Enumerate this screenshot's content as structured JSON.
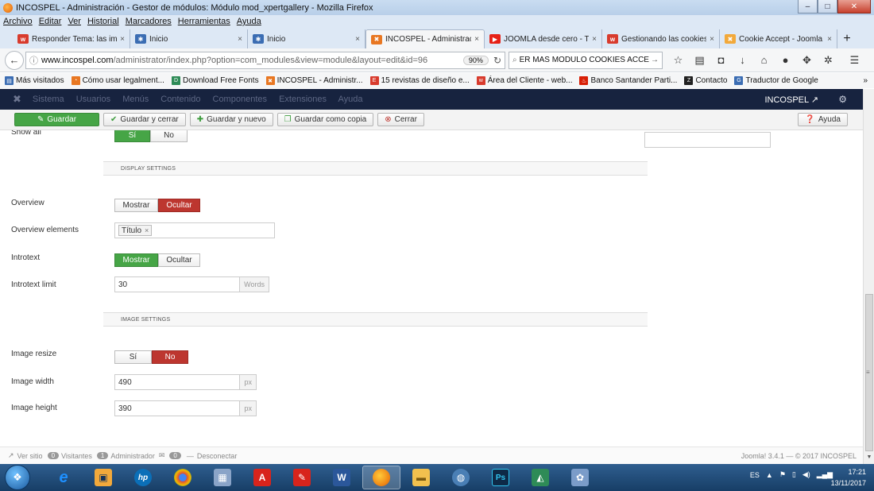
{
  "window": {
    "title": "INCOSPEL - Administración - Gestor de módulos: Módulo mod_xpertgallery - Mozilla Firefox",
    "minimize": "‒",
    "maximize": "□",
    "close": "✕"
  },
  "menubar": [
    "Archivo",
    "Editar",
    "Ver",
    "Historial",
    "Marcadores",
    "Herramientas",
    "Ayuda"
  ],
  "tabs": [
    {
      "label": "Responder Tema: las imá",
      "icon": "w-icon",
      "color": "#d83b2d"
    },
    {
      "label": "Inicio",
      "icon": "joomla-icon",
      "color": "#3b6db3"
    },
    {
      "label": "Inicio",
      "icon": "joomla-icon",
      "color": "#3b6db3"
    },
    {
      "label": "INCOSPEL - Administrac",
      "icon": "incospel-icon",
      "color": "#e87722"
    },
    {
      "label": "JOOMLA desde cero - Tu",
      "icon": "youtube-icon",
      "color": "#e62117"
    },
    {
      "label": "Gestionando las cookies",
      "icon": "w-icon",
      "color": "#d83b2d"
    },
    {
      "label": "Cookie Accept - Joomla",
      "icon": "cookie-icon",
      "color": "#f2a93b"
    }
  ],
  "tab_close": "×",
  "tab_new": "+",
  "nav": {
    "url_domain": "www.incospel.com",
    "url_path": "/administrator/index.php?option=com_modules&view=module&layout=edit&id=96",
    "zoom": "90%",
    "search": "ER MAS MODULO COOKIES ACCEPT",
    "search_go": "→"
  },
  "bookmarks": [
    {
      "label": "Más visitados",
      "color": "#3b6db3"
    },
    {
      "label": "Cómo usar legalment...",
      "color": "#e87722"
    },
    {
      "label": "Download Free Fonts",
      "color": "#2e8b57"
    },
    {
      "label": "INCOSPEL - Administr...",
      "color": "#e87722"
    },
    {
      "label": "15 revistas de diseño e...",
      "color": "#d83b2d"
    },
    {
      "label": "Área del Cliente - web...",
      "color": "#d83b2d"
    },
    {
      "label": "Banco Santander Parti...",
      "color": "#d81e05"
    },
    {
      "label": "Contacto",
      "color": "#222222"
    },
    {
      "label": "Traductor de Google",
      "color": "#3b6db3"
    }
  ],
  "bookmarks_more": "»",
  "joomla": {
    "logo": "✖",
    "menu": [
      "Sistema",
      "Usuarios",
      "Menús",
      "Contenido",
      "Componentes",
      "Extensiones",
      "Ayuda"
    ],
    "site": "INCOSPEL",
    "site_icon": "↗",
    "gear": "⚙"
  },
  "toolbar": {
    "save": "Guardar",
    "save_close": "Guardar y cerrar",
    "save_new": "Guardar y nuevo",
    "save_copy": "Guardar como copia",
    "close": "Cerrar",
    "help": "Ayuda"
  },
  "form": {
    "show_all": {
      "label": "Show all",
      "yes": "Sí",
      "no": "No"
    },
    "display_settings": "DISPLAY SETTINGS",
    "overview": {
      "label": "Overview",
      "show": "Mostrar",
      "hide": "Ocultar",
      "selected": "Ocultar"
    },
    "overview_elements": {
      "label": "Overview elements",
      "chip": "Título",
      "chip_remove": "×"
    },
    "introtext": {
      "label": "Introtext",
      "show": "Mostrar",
      "hide": "Ocultar",
      "selected": "Mostrar"
    },
    "introtext_limit": {
      "label": "Introtext limit",
      "value": "30",
      "unit": "Words"
    },
    "image_settings": "IMAGE SETTINGS",
    "image_resize": {
      "label": "Image resize",
      "yes": "Sí",
      "no": "No",
      "selected": "No"
    },
    "image_width": {
      "label": "Image width",
      "value": "490",
      "unit": "px"
    },
    "image_height": {
      "label": "Image height",
      "value": "390",
      "unit": "px"
    }
  },
  "statusbar": {
    "view_site": "Ver sitio",
    "visitors_count": "0",
    "visitors": "Visitantes",
    "admin_count": "1",
    "admin": "Administrador",
    "messages_count": "0",
    "logout": "Desconectar",
    "version": "Joomla! 3.4.1 — © 2017 INCOSPEL"
  },
  "taskbar": {
    "apps": [
      {
        "name": "internet-explorer",
        "glyph": "e",
        "color": "#1e90ff"
      },
      {
        "name": "media",
        "glyph": "▣",
        "color": "#f2a93b"
      },
      {
        "name": "hp",
        "glyph": "hp",
        "color": "#0b6fb8"
      },
      {
        "name": "chrome",
        "glyph": "◉",
        "color": "#dd4b39"
      },
      {
        "name": "calculator",
        "glyph": "▦",
        "color": "#8aa4c8"
      },
      {
        "name": "acrobat",
        "glyph": "A",
        "color": "#d8241c"
      },
      {
        "name": "paint",
        "glyph": "✎",
        "color": "#d8241c"
      },
      {
        "name": "word",
        "glyph": "W",
        "color": "#2b579a"
      },
      {
        "name": "firefox",
        "glyph": "◐",
        "color": "#e66000"
      },
      {
        "name": "explorer",
        "glyph": "▬",
        "color": "#f2c14e"
      },
      {
        "name": "network",
        "glyph": "◍",
        "color": "#4a7fb5"
      },
      {
        "name": "photoshop",
        "glyph": "Ps",
        "color": "#0e2a47"
      },
      {
        "name": "dreamweaver",
        "glyph": "◭",
        "color": "#2e8b57"
      },
      {
        "name": "paint-palette",
        "glyph": "✿",
        "color": "#7b9cc9"
      }
    ],
    "lang": "ES",
    "time": "17:21",
    "date": "13/11/2017"
  }
}
